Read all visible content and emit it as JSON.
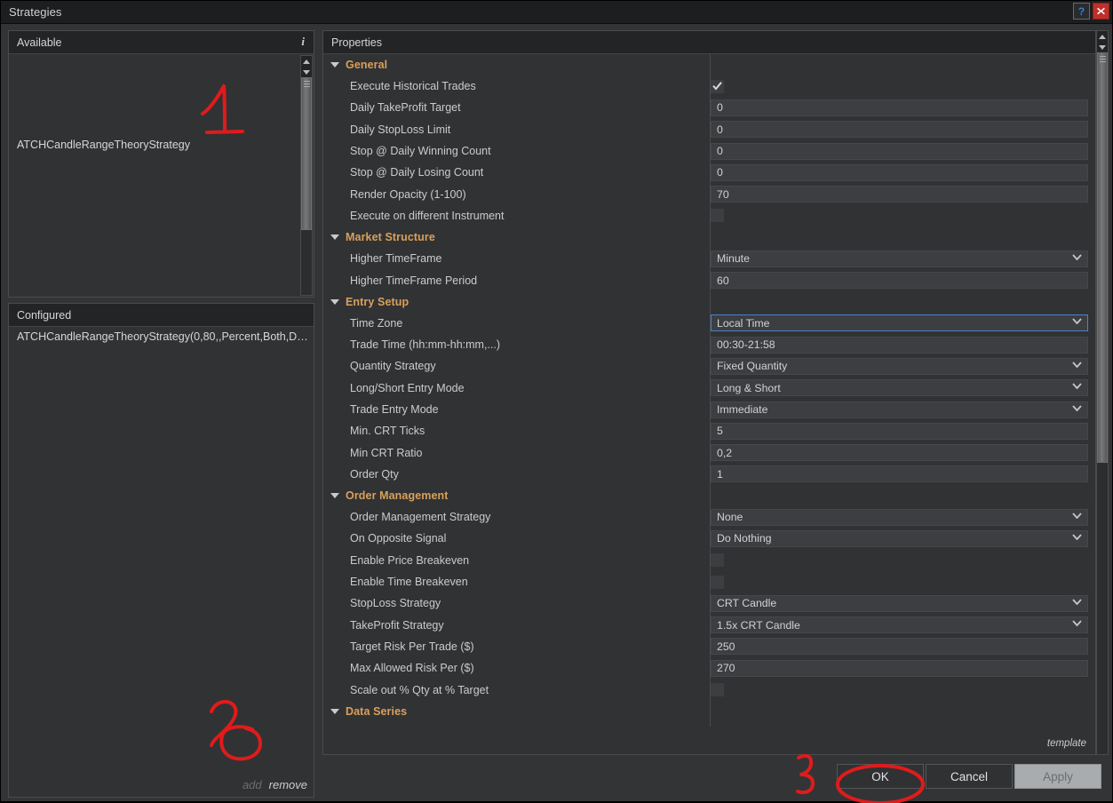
{
  "window": {
    "title": "Strategies",
    "help_label": "?",
    "close_label": "x"
  },
  "available_panel": {
    "header": "Available",
    "info_icon": "i",
    "items": [
      "ATCHCandleRangeTheoryStrategy"
    ]
  },
  "configured_panel": {
    "header": "Configured",
    "items": [
      "ATCHCandleRangeTheoryStrategy(0,80,,Percent,Both,Do…"
    ],
    "add_label": "add",
    "remove_label": "remove"
  },
  "properties_panel": {
    "header": "Properties",
    "template_label": "template",
    "groups": [
      {
        "label": "General",
        "rows": [
          {
            "label": "Execute Historical Trades",
            "type": "checkbox",
            "value": true
          },
          {
            "label": "Daily TakeProfit Target",
            "type": "text",
            "value": "0"
          },
          {
            "label": "Daily StopLoss Limit",
            "type": "text",
            "value": "0"
          },
          {
            "label": "Stop @ Daily Winning Count",
            "type": "text",
            "value": "0"
          },
          {
            "label": "Stop @ Daily Losing Count",
            "type": "text",
            "value": "0"
          },
          {
            "label": "Render Opacity (1-100)",
            "type": "text",
            "value": "70"
          },
          {
            "label": "Execute on different Instrument",
            "type": "checkbox",
            "value": false
          }
        ]
      },
      {
        "label": "Market Structure",
        "rows": [
          {
            "label": "Higher TimeFrame",
            "type": "select",
            "value": "Minute"
          },
          {
            "label": "Higher TimeFrame Period",
            "type": "text",
            "value": "60"
          }
        ]
      },
      {
        "label": "Entry Setup",
        "rows": [
          {
            "label": "Time Zone",
            "type": "select",
            "value": "Local Time",
            "focused": true
          },
          {
            "label": "Trade Time (hh:mm-hh:mm,...)",
            "type": "text",
            "value": "00:30-21:58"
          },
          {
            "label": "Quantity Strategy",
            "type": "select",
            "value": "Fixed Quantity"
          },
          {
            "label": "Long/Short Entry Mode",
            "type": "select",
            "value": "Long & Short"
          },
          {
            "label": "Trade Entry Mode",
            "type": "select",
            "value": "Immediate"
          },
          {
            "label": "Min. CRT Ticks",
            "type": "text",
            "value": "5"
          },
          {
            "label": "Min CRT Ratio",
            "type": "text",
            "value": "0,2"
          },
          {
            "label": "Order Qty",
            "type": "text",
            "value": "1"
          }
        ]
      },
      {
        "label": "Order Management",
        "rows": [
          {
            "label": "Order Management Strategy",
            "type": "select",
            "value": "None"
          },
          {
            "label": "On Opposite Signal",
            "type": "select",
            "value": "Do Nothing"
          },
          {
            "label": "Enable Price Breakeven",
            "type": "checkbox",
            "value": false
          },
          {
            "label": "Enable Time Breakeven",
            "type": "checkbox",
            "value": false
          },
          {
            "label": "StopLoss Strategy",
            "type": "select",
            "value": "CRT Candle"
          },
          {
            "label": "TakeProfit Strategy",
            "type": "select",
            "value": "1.5x CRT Candle"
          },
          {
            "label": "Target Risk Per Trade ($)",
            "type": "text",
            "value": "250"
          },
          {
            "label": "Max Allowed Risk Per ($)",
            "type": "text",
            "value": "270"
          },
          {
            "label": "Scale out % Qty at % Target",
            "type": "checkbox",
            "value": false
          }
        ]
      },
      {
        "label": "Data Series",
        "rows": []
      }
    ]
  },
  "footer": {
    "ok_label": "OK",
    "cancel_label": "Cancel",
    "apply_label": "Apply"
  },
  "annotations": [
    {
      "name": "step-1",
      "text": "1",
      "color": "#e01b1b"
    },
    {
      "name": "step-2",
      "text": "2",
      "color": "#e01b1b"
    },
    {
      "name": "step-3",
      "text": "3",
      "color": "#e01b1b"
    }
  ],
  "colors": {
    "group_header": "#d9a05a",
    "focus_border": "#4a84c4",
    "annotation": "#e01b1b",
    "close_button": "#c0302a",
    "help_glyph": "#2f7fd8"
  }
}
